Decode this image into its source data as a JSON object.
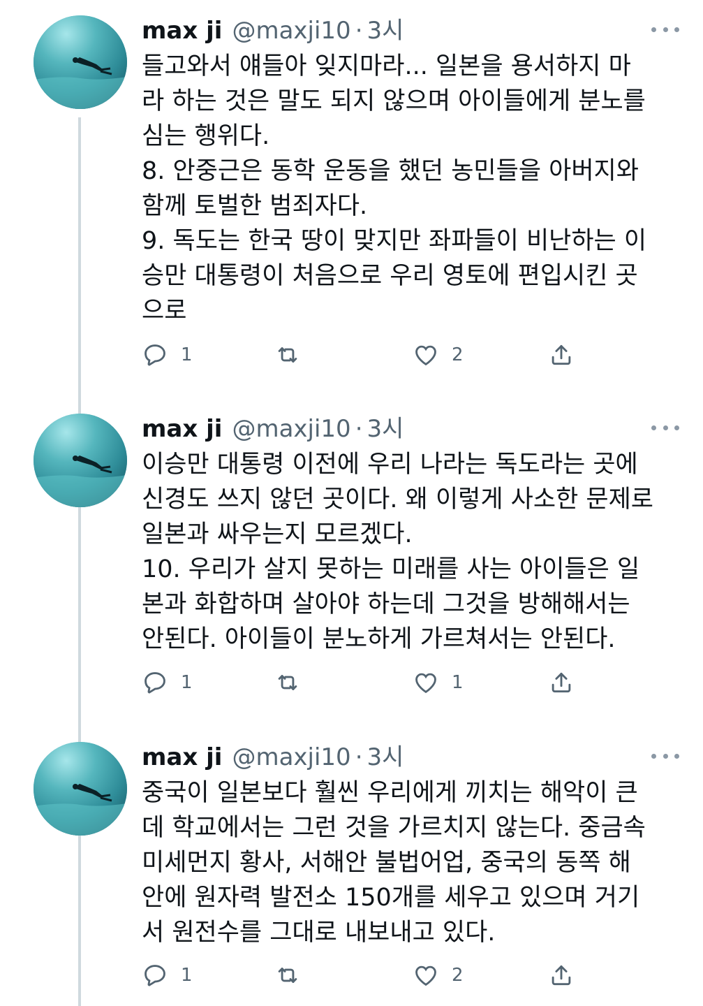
{
  "tweets": [
    {
      "name": "max ji",
      "handle": "@maxji10",
      "separator": "·",
      "time": "3시",
      "lines": [
        "들고와서 얘들아 잊지마라... 일본을 용서하지 마",
        "라 하는 것은 말도 되지 않으며 아이들에게 분노를",
        "심는 행위다.",
        "8. 안중근은 동학 운동을 했던 농민들을 아버지와",
        "함께 토벌한 범죄자다.",
        "9. 독도는 한국 땅이 맞지만 좌파들이 비난하는 이",
        "승만 대통령이 처음으로 우리 영토에 편입시킨 곳",
        "으로"
      ],
      "reply_count": "1",
      "retweet_count": "",
      "like_count": "2"
    },
    {
      "name": "max ji",
      "handle": "@maxji10",
      "separator": "·",
      "time": "3시",
      "lines": [
        "이승만 대통령 이전에 우리 나라는 독도라는 곳에",
        "신경도 쓰지 않던 곳이다. 왜 이렇게 사소한 문제로",
        "일본과 싸우는지 모르겠다.",
        "10. 우리가 살지 못하는 미래를 사는 아이들은 일",
        "본과 화합하며 살아야 하는데 그것을 방해해서는",
        "안된다. 아이들이 분노하게 가르쳐서는 안된다."
      ],
      "reply_count": "1",
      "retweet_count": "",
      "like_count": "1"
    },
    {
      "name": "max ji",
      "handle": "@maxji10",
      "separator": "·",
      "time": "3시",
      "lines": [
        "중국이 일본보다 훨씬 우리에게 끼치는 해악이 큰",
        "데 학교에서는 그런 것을 가르치지 않는다. 중금속",
        "미세먼지 황사, 서해안 불법어업, 중국의 동쪽 해",
        "안에 원자력 발전소 150개를 세우고 있으며 거기",
        "서 원전수를 그대로 내보내고 있다."
      ],
      "reply_count": "1",
      "retweet_count": "",
      "like_count": "2"
    }
  ],
  "icons": {
    "reply": "reply-icon",
    "retweet": "retweet-icon",
    "like": "heart-icon",
    "share": "share-icon",
    "more": "more-dots-icon"
  },
  "colors": {
    "text": "#0f1419",
    "secondary": "#536471",
    "thread_line": "#cfd9de",
    "avatar_water": "#2e8b98"
  }
}
